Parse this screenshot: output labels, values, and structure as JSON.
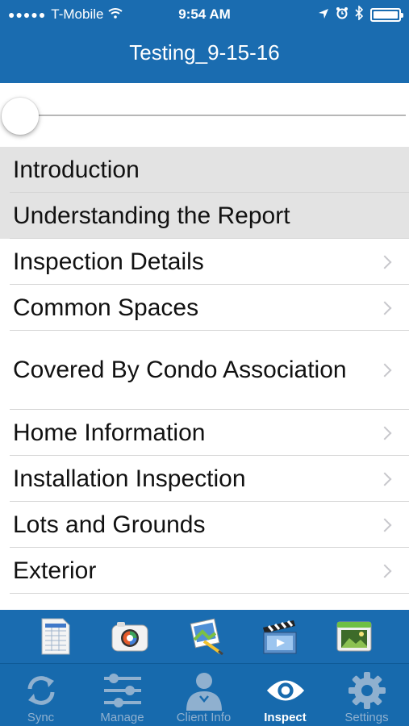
{
  "status_bar": {
    "carrier": "T-Mobile",
    "time": "9:54 AM"
  },
  "nav": {
    "title": "Testing_9-15-16"
  },
  "slider": {
    "progress": 0
  },
  "sections": [
    {
      "label": "Introduction",
      "style": "gray",
      "has_chevron": false
    },
    {
      "label": "Understanding the Report",
      "style": "gray",
      "has_chevron": false
    },
    {
      "label": "Inspection Details",
      "style": "white",
      "has_chevron": true
    },
    {
      "label": "Common Spaces",
      "style": "white",
      "has_chevron": true
    },
    {
      "label": "Covered By Condo Association",
      "style": "white",
      "has_chevron": true
    },
    {
      "label": "Home Information",
      "style": "white",
      "has_chevron": true
    },
    {
      "label": "Installation Inspection",
      "style": "white",
      "has_chevron": true
    },
    {
      "label": "Lots and Grounds",
      "style": "white",
      "has_chevron": true
    },
    {
      "label": "Exterior",
      "style": "white",
      "has_chevron": true
    }
  ],
  "toolbar": {
    "icons": [
      "spreadsheet-icon",
      "camera-icon",
      "photo-edit-icon",
      "video-clapper-icon",
      "photo-gallery-icon"
    ]
  },
  "tabs": [
    {
      "label": "Sync",
      "icon": "sync-icon",
      "active": false
    },
    {
      "label": "Manage",
      "icon": "sliders-icon",
      "active": false
    },
    {
      "label": "Client Info",
      "icon": "person-icon",
      "active": false
    },
    {
      "label": "Inspect",
      "icon": "eye-icon",
      "active": true
    },
    {
      "label": "Settings",
      "icon": "gear-icon",
      "active": false
    }
  ],
  "colors": {
    "brand_blue": "#1a6cb0",
    "tab_inactive": "#8fb0cf",
    "tab_active": "#ffffff",
    "section_gray": "#e3e3e3"
  }
}
